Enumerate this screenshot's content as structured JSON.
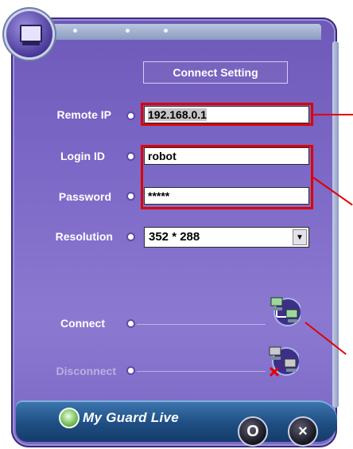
{
  "section_title": "Connect Setting",
  "fields": {
    "remote_ip": {
      "label": "Remote IP",
      "value": "192.168.0.1"
    },
    "login_id": {
      "label": "Login ID",
      "value": "robot"
    },
    "password": {
      "label": "Password",
      "value": "*****"
    },
    "resolution": {
      "label": "Resolution",
      "value": "352 * 288"
    }
  },
  "actions": {
    "connect_label": "Connect",
    "disconnect_label": "Disconnect"
  },
  "brand": "My Guard Live",
  "bottom_buttons": {
    "minimize": "O",
    "close": "×"
  },
  "icons": {
    "app": "monitor-icon",
    "connect": "network-connect-icon",
    "disconnect": "network-disconnect-icon",
    "dropdown": "chevron-down-icon"
  },
  "colors": {
    "panel": "#7c68c6",
    "annotation": "#e00000",
    "bottom_bar": "#1f4e84"
  }
}
